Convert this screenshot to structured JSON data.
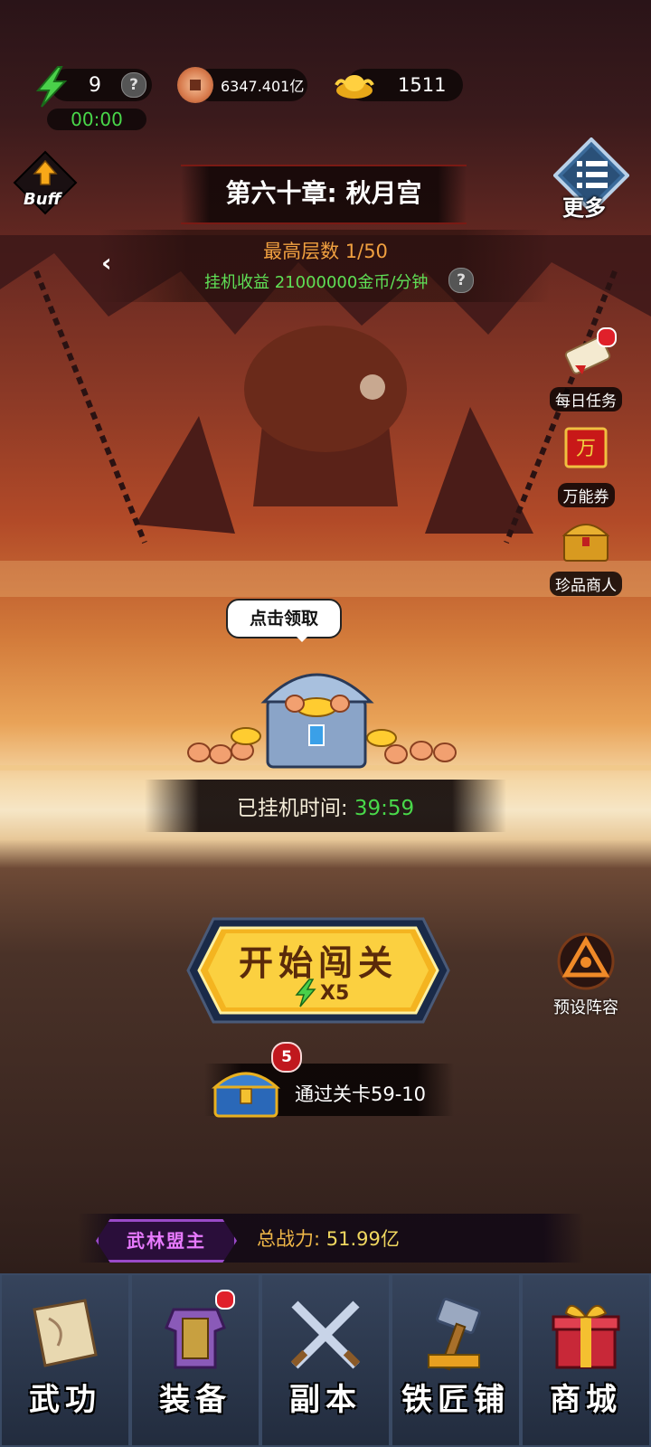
{
  "resources": {
    "energy": "9",
    "energy_timer": "00:00",
    "copper": "6347.401亿",
    "gold": "1511",
    "help_mark": "?"
  },
  "buff": {
    "label": "Buff"
  },
  "chapter": {
    "title": "第六十章: 秋月宫"
  },
  "more": {
    "label": "更多"
  },
  "floor": {
    "best_floor": "最高层数 1/50",
    "income": "挂机收益 21000000金币/分钟"
  },
  "side_menu": [
    {
      "label": "每日任务",
      "has_alert": true
    },
    {
      "label": "万能券",
      "has_alert": false
    },
    {
      "label": "珍品商人",
      "has_alert": false
    }
  ],
  "chest": {
    "bubble": "点击领取",
    "idle_label": "已挂机时间:",
    "idle_time": "39:59"
  },
  "start": {
    "label": "开始闯关",
    "cost": "X5"
  },
  "preset": {
    "label": "预设阵容"
  },
  "stage_reward": {
    "count": "5",
    "text": "通过关卡59-10"
  },
  "power": {
    "badge": "武林盟主",
    "label": "总战力:",
    "value": "51.99亿"
  },
  "nav": [
    {
      "label": "武功",
      "icon": "scroll-icon",
      "has_alert": false
    },
    {
      "label": "装备",
      "icon": "armor-icon",
      "has_alert": true
    },
    {
      "label": "副本",
      "icon": "crossed-swords-icon",
      "has_alert": false
    },
    {
      "label": "铁匠铺",
      "icon": "hammer-icon",
      "has_alert": false
    },
    {
      "label": "商城",
      "icon": "gift-box-icon",
      "has_alert": false
    }
  ],
  "colors": {
    "energy_green": "#49d84a",
    "income_green": "#5fe056",
    "floor_orange": "#f0a040",
    "badge_purple": "#9a4ac8",
    "alert_red": "#e0202a"
  }
}
